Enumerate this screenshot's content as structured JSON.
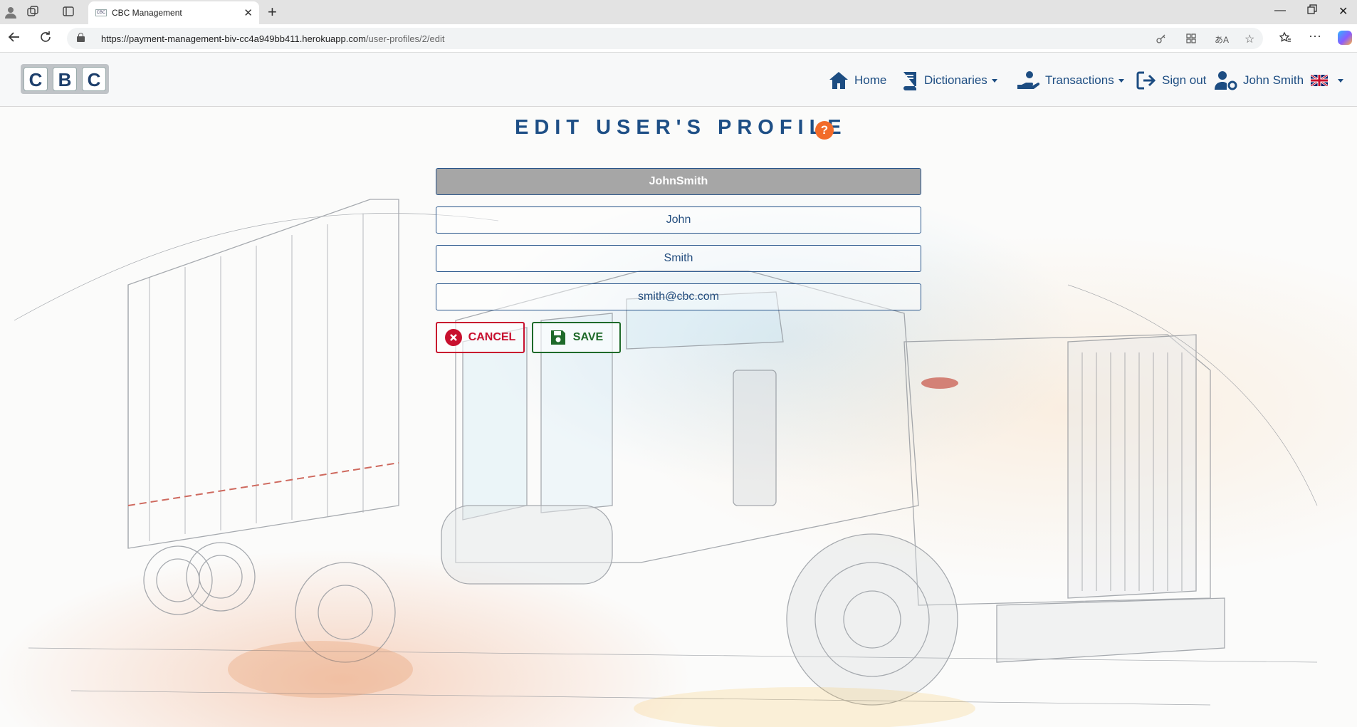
{
  "browser": {
    "tab_title": "CBC Management",
    "url_main": "https://payment-management-biv-cc4a949bb411.herokuapp.com",
    "url_path": "/user-profiles/2/edit"
  },
  "site": {
    "logo_letters": [
      "C",
      "B",
      "C"
    ],
    "nav": {
      "home": "Home",
      "dictionaries": "Dictionaries",
      "transactions": "Transactions",
      "sign_out": "Sign out",
      "user": "John Smith"
    },
    "page_title": "EDIT USER'S PROFILE",
    "help_glyph": "?",
    "form": {
      "username": "JohnSmith",
      "first_name": "John",
      "last_name": "Smith",
      "email": "smith@cbc.com"
    },
    "buttons": {
      "cancel": "CANCEL",
      "save": "SAVE"
    }
  },
  "colors": {
    "brand_blue": "#1e4f86",
    "cancel_red": "#c8102e",
    "save_green": "#1f6a2a",
    "help_orange": "#f26b2a"
  }
}
